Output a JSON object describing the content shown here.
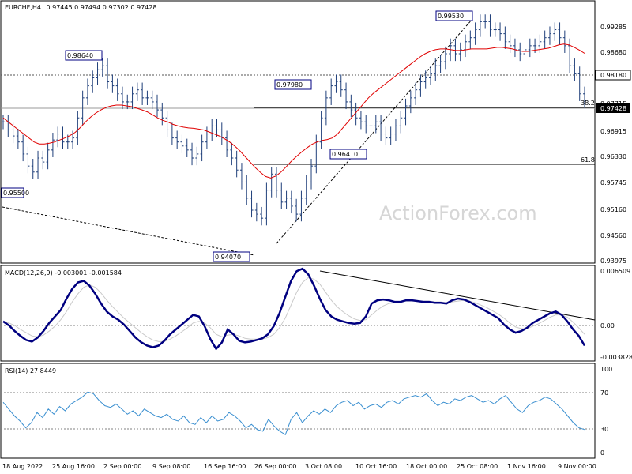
{
  "header": {
    "symbol": "EURCHF,H4",
    "ohlc": "0.97445 0.97494 0.97302 0.97428"
  },
  "watermark": "ActionForex.com",
  "colors": {
    "bars": "#1f3f7a",
    "ma": "#e00000",
    "macd": "#000080",
    "signal": "#c9c9c9",
    "rsi": "#3a8fd0",
    "grid": "#808080"
  },
  "chart_data": [
    {
      "type": "ohlc",
      "title": "EURCHF,H4",
      "ylim": [
        0.934,
        0.999
      ],
      "y_ticks": [
        "0.99285",
        "0.98680",
        "0.98180",
        "0.97715",
        "0.96915",
        "0.96330",
        "0.95745",
        "0.95160",
        "0.94560",
        "0.93975"
      ],
      "current_price": "0.97428",
      "x_ticks": [
        "18 Aug 2022",
        "25 Aug 16:00",
        "2 Sep 00:00",
        "9 Sep 08:00",
        "16 Sep 16:00",
        "26 Sep 00:00",
        "3 Oct 08:00",
        "10 Oct 16:00",
        "18 Oct 00:00",
        "25 Oct 08:00",
        "1 Nov 16:00",
        "9 Nov 00:00"
      ],
      "annotations": [
        "0.95500",
        "0.98640",
        "0.94070",
        "0.97980",
        "0.96410",
        "0.99530",
        "38.2",
        "61.8"
      ],
      "levels": {
        "resistance": 0.9818,
        "fib_382": 0.9755,
        "fib_618": 0.9624
      },
      "series": [
        {
          "name": "",
          "kind": "close",
          "values": [
            0.969,
            0.967,
            0.9655,
            0.964,
            0.961,
            0.958,
            0.9565,
            0.96,
            0.959,
            0.962,
            0.9645,
            0.966,
            0.964,
            0.964,
            0.965,
            0.97,
            0.975,
            0.978,
            0.98,
            0.982,
            0.983,
            0.979,
            0.978,
            0.976,
            0.974,
            0.974,
            0.976,
            0.977,
            0.975,
            0.975,
            0.974,
            0.972,
            0.97,
            0.967,
            0.965,
            0.964,
            0.963,
            0.962,
            0.96,
            0.961,
            0.964,
            0.966,
            0.968,
            0.967,
            0.965,
            0.962,
            0.96,
            0.957,
            0.954,
            0.95,
            0.947,
            0.946,
            0.945,
            0.952,
            0.956,
            0.952,
            0.949,
            0.95,
            0.948,
            0.946,
            0.95,
            0.954,
            0.958,
            0.964,
            0.97,
            0.975,
            0.978,
            0.979,
            0.977,
            0.974,
            0.972,
            0.97,
            0.969,
            0.968,
            0.968,
            0.969,
            0.966,
            0.965,
            0.966,
            0.968,
            0.97,
            0.973,
            0.975,
            0.977,
            0.979,
            0.98,
            0.981,
            0.983,
            0.984,
            0.986,
            0.988,
            0.986,
            0.987,
            0.989,
            0.99,
            0.992,
            0.994,
            0.994,
            0.992,
            0.992,
            0.991,
            0.989,
            0.988,
            0.987,
            0.986,
            0.987,
            0.988,
            0.988,
            0.989,
            0.99,
            0.991,
            0.992,
            0.99,
            0.988,
            0.983,
            0.981,
            0.976,
            0.9743
          ]
        },
        {
          "name": "",
          "kind": "moving_average",
          "values": [
            0.97,
            0.969,
            0.968,
            0.967,
            0.966,
            0.965,
            0.964,
            0.9635,
            0.9635,
            0.9637,
            0.964,
            0.9645,
            0.965,
            0.9656,
            0.9664,
            0.9676,
            0.969,
            0.9702,
            0.9712,
            0.972,
            0.9726,
            0.973,
            0.9732,
            0.9732,
            0.973,
            0.9728,
            0.9724,
            0.972,
            0.9715,
            0.9708,
            0.97,
            0.9694,
            0.969,
            0.9684,
            0.968,
            0.9677,
            0.9675,
            0.9674,
            0.9672,
            0.967,
            0.9665,
            0.966,
            0.9655,
            0.9648,
            0.964,
            0.963,
            0.9618,
            0.9604,
            0.959,
            0.9576,
            0.9564,
            0.9554,
            0.955,
            0.9555,
            0.9565,
            0.9578,
            0.9592,
            0.9604,
            0.9615,
            0.9625,
            0.9634,
            0.964,
            0.9644,
            0.9646,
            0.965,
            0.966,
            0.9675,
            0.969,
            0.9705,
            0.972,
            0.9735,
            0.975,
            0.9762,
            0.9772,
            0.9782,
            0.9792,
            0.9802,
            0.9812,
            0.9822,
            0.9832,
            0.9842,
            0.9852,
            0.986,
            0.9866,
            0.987,
            0.9872,
            0.9872,
            0.987,
            0.9868,
            0.9868,
            0.987,
            0.9872,
            0.9872,
            0.9872,
            0.9872,
            0.9874,
            0.9876,
            0.9876,
            0.9874,
            0.9872,
            0.9868,
            0.9866,
            0.9866,
            0.9868,
            0.987,
            0.9872,
            0.9874,
            0.9878,
            0.9882,
            0.9884,
            0.9882,
            0.9876,
            0.9869,
            0.9861
          ]
        }
      ]
    },
    {
      "type": "line",
      "title": "MACD(12,26,9) -0.003001 -0.001584",
      "ylim": [
        -0.0048,
        0.0068
      ],
      "y_ticks": [
        "0.006509",
        "0.00",
        "-0.003828"
      ],
      "series": [
        {
          "name": "",
          "kind": "macd",
          "values": [
            0.0,
            -0.0005,
            -0.0012,
            -0.0018,
            -0.0023,
            -0.0025,
            -0.002,
            -0.0012,
            -0.0002,
            0.0006,
            0.0014,
            0.0028,
            0.004,
            0.0048,
            0.005,
            0.0044,
            0.0034,
            0.0022,
            0.0012,
            0.0006,
            0.0002,
            -0.0004,
            -0.0012,
            -0.002,
            -0.0026,
            -0.003,
            -0.0032,
            -0.003,
            -0.0024,
            -0.0016,
            -0.001,
            -0.0004,
            0.0002,
            0.0008,
            0.0006,
            -0.0006,
            -0.0022,
            -0.0034,
            -0.0026,
            -0.001,
            -0.0016,
            -0.0024,
            -0.0026,
            -0.0025,
            -0.0023,
            -0.0021,
            -0.0016,
            -0.0006,
            0.001,
            0.003,
            0.005,
            0.0062,
            0.0065,
            0.0058,
            0.0044,
            0.0028,
            0.0014,
            0.0006,
            0.0002,
            0.0,
            -0.0002,
            -0.0003,
            -0.0002,
            0.0006,
            0.0022,
            0.0026,
            0.0027,
            0.0026,
            0.0024,
            0.0024,
            0.0026,
            0.0026,
            0.0025,
            0.0024,
            0.0024,
            0.0023,
            0.0023,
            0.0022,
            0.0026,
            0.0028,
            0.0027,
            0.0024,
            0.002,
            0.0016,
            0.0012,
            0.0008,
            0.0004,
            -0.0004,
            -0.001,
            -0.0014,
            -0.0012,
            -0.0008,
            -0.0002,
            0.0002,
            0.0006,
            0.001,
            0.0012,
            0.0008,
            0.0,
            -0.001,
            -0.0018,
            -0.003
          ]
        },
        {
          "name": "",
          "kind": "signal",
          "values": [
            0.0,
            -0.0002,
            -0.0005,
            -0.001,
            -0.0014,
            -0.0018,
            -0.0019,
            -0.0017,
            -0.0012,
            -0.0006,
            0.0002,
            0.0012,
            0.0024,
            0.0034,
            0.0042,
            0.0045,
            0.0042,
            0.0035,
            0.0026,
            0.0018,
            0.0011,
            0.0004,
            -0.0002,
            -0.0008,
            -0.0014,
            -0.0019,
            -0.0023,
            -0.0025,
            -0.0025,
            -0.0022,
            -0.0018,
            -0.0013,
            -0.0008,
            -0.0002,
            0.0,
            -0.0002,
            -0.0008,
            -0.0016,
            -0.0019,
            -0.0017,
            -0.0016,
            -0.0018,
            -0.0021,
            -0.0022,
            -0.0022,
            -0.0022,
            -0.002,
            -0.0016,
            -0.0008,
            0.0004,
            0.002,
            0.0036,
            0.0048,
            0.0054,
            0.0052,
            0.0046,
            0.0036,
            0.0026,
            0.0018,
            0.0012,
            0.0007,
            0.0003,
            0.0001,
            0.0002,
            0.0008,
            0.0014,
            0.0019,
            0.0022,
            0.0023,
            0.0024,
            0.0025,
            0.0025,
            0.0025,
            0.0025,
            0.0025,
            0.0024,
            0.0024,
            0.0023,
            0.0024,
            0.0025,
            0.0026,
            0.0025,
            0.0023,
            0.002,
            0.0017,
            0.0013,
            0.0009,
            0.0004,
            -0.0002,
            -0.0007,
            -0.0009,
            -0.0009,
            -0.0006,
            -0.0003,
            0.0001,
            0.0005,
            0.0008,
            0.0008,
            0.0005,
            -0.0001,
            -0.0008,
            -0.0016
          ]
        }
      ]
    },
    {
      "type": "line",
      "title": "RSI(14) 27.8449",
      "ylim": [
        0,
        100
      ],
      "y_ticks": [
        "100",
        "70",
        "30",
        "0"
      ],
      "series": [
        {
          "name": "",
          "values": [
            60,
            52,
            44,
            38,
            30,
            36,
            48,
            42,
            52,
            46,
            55,
            50,
            58,
            62,
            66,
            72,
            70,
            62,
            56,
            54,
            58,
            52,
            46,
            50,
            44,
            52,
            48,
            44,
            42,
            46,
            40,
            38,
            44,
            36,
            34,
            42,
            36,
            44,
            38,
            40,
            48,
            44,
            38,
            30,
            34,
            28,
            26,
            40,
            32,
            26,
            22,
            40,
            48,
            36,
            44,
            50,
            46,
            52,
            48,
            56,
            60,
            62,
            56,
            60,
            52,
            56,
            58,
            54,
            60,
            62,
            58,
            64,
            66,
            68,
            66,
            70,
            62,
            56,
            60,
            58,
            64,
            62,
            66,
            68,
            64,
            60,
            62,
            58,
            64,
            68,
            60,
            52,
            48,
            56,
            60,
            62,
            66,
            64,
            58,
            52,
            44,
            36,
            30,
            28
          ]
        }
      ]
    }
  ]
}
